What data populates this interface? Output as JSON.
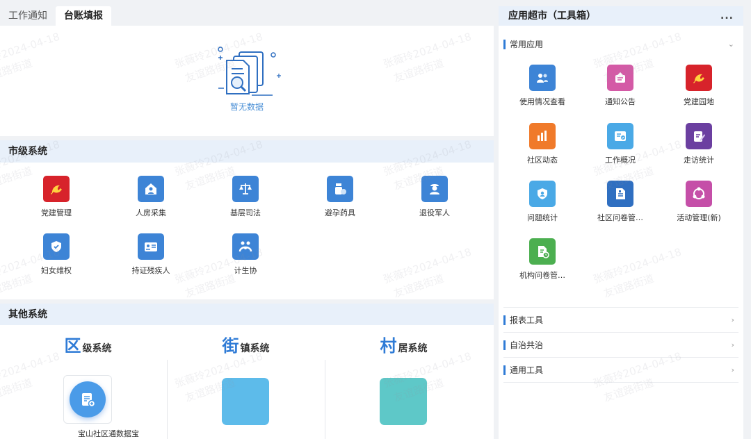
{
  "tabs": [
    {
      "label": "工作通知"
    },
    {
      "label": "台账填报"
    }
  ],
  "empty": {
    "text": "暂无数据"
  },
  "city": {
    "title": "市级系统",
    "apps": [
      {
        "label": "党建管理",
        "icon": "party-flag-icon",
        "color": "#d7232b"
      },
      {
        "label": "人房采集",
        "icon": "house-person-icon",
        "color": "#3d84d6"
      },
      {
        "label": "基层司法",
        "icon": "scales-icon",
        "color": "#3d84d6"
      },
      {
        "label": "避孕药具",
        "icon": "medicine-icon",
        "color": "#3d84d6"
      },
      {
        "label": "退役军人",
        "icon": "soldier-icon",
        "color": "#3d84d6"
      },
      {
        "label": "妇女维权",
        "icon": "shield-check-icon",
        "color": "#3d84d6"
      },
      {
        "label": "持证残疾人",
        "icon": "id-card-icon",
        "color": "#3d84d6"
      },
      {
        "label": "计生协",
        "icon": "family-icon",
        "color": "#3d84d6"
      }
    ]
  },
  "other": {
    "title": "其他系统",
    "systems": [
      {
        "big": "区",
        "rest": "级系统",
        "tile_color": "#ffffff"
      },
      {
        "big": "街",
        "rest": "镇系统",
        "tile_color": "#5dbbea"
      },
      {
        "big": "村",
        "rest": "居系统",
        "tile_color": "#5ec8c8"
      }
    ],
    "district_app": {
      "label": "宝山社区通数据宝",
      "icon": "data-treasure-icon"
    }
  },
  "toolbox": {
    "title": "应用超市（工具箱）",
    "more": "...",
    "common": {
      "title": "常用应用",
      "apps": [
        {
          "label": "使用情况查看",
          "icon": "users-icon",
          "color": "#3d84d6"
        },
        {
          "label": "通知公告",
          "icon": "notice-icon",
          "color": "#d45aa6"
        },
        {
          "label": "党建园地",
          "icon": "party-flag-icon",
          "color": "#d7232b"
        },
        {
          "label": "社区动态",
          "icon": "bar-chart-icon",
          "color": "#f07a2a"
        },
        {
          "label": "工作概况",
          "icon": "checklist-icon",
          "color": "#4aa9e6"
        },
        {
          "label": "走访统计",
          "icon": "edit-doc-icon",
          "color": "#6b3fa0"
        },
        {
          "label": "问题统计",
          "icon": "shield-user-icon",
          "color": "#4aa9e6"
        },
        {
          "label": "社区问卷管…",
          "icon": "doc-icon",
          "color": "#2f6fc1"
        },
        {
          "label": "活动管理(新)",
          "icon": "people-circle-icon",
          "color": "#c54fa8"
        },
        {
          "label": "机构问卷管…",
          "icon": "sheet-clock-icon",
          "color": "#4caf50"
        }
      ]
    },
    "groups": [
      {
        "title": "报表工具"
      },
      {
        "title": "自治共治"
      },
      {
        "title": "通用工具"
      }
    ]
  },
  "watermark": {
    "line1": "张薇玲2024-04-18",
    "line2": "友谊路街道"
  }
}
